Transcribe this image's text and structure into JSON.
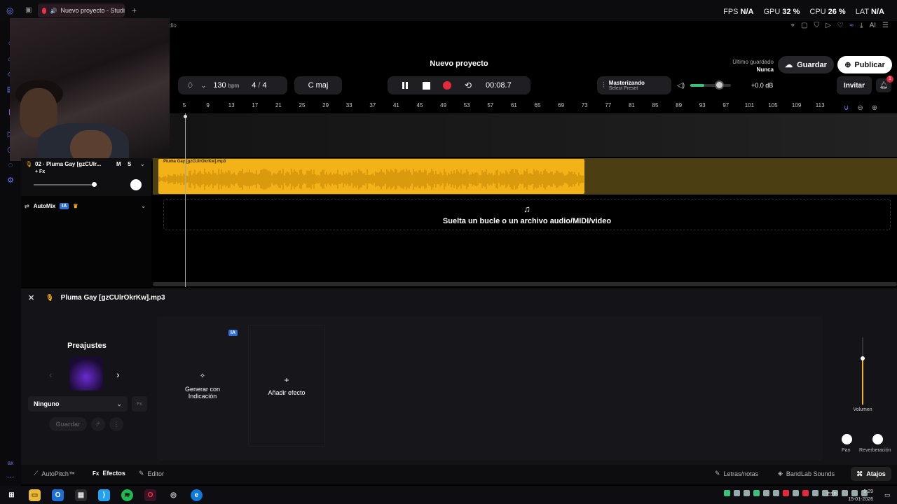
{
  "browser": {
    "tab_title": "Nuevo proyecto - Studi",
    "partial_title": "dio",
    "stats": [
      {
        "label": "FPS",
        "value": "N/A"
      },
      {
        "label": "GPU",
        "value": "32 %"
      },
      {
        "label": "CPU",
        "value": "26 %"
      },
      {
        "label": "LAT",
        "value": "N/A"
      }
    ],
    "extension_icons": [
      "pin-icon",
      "box-icon",
      "shield-icon",
      "play-icon",
      "heart-icon",
      "wave-icon",
      "download-icon",
      "ai-icon",
      "menu-icon"
    ]
  },
  "header": {
    "project_title": "Nuevo proyecto",
    "last_saved_label": "Último guardado",
    "last_saved_value": "Nunca",
    "save_label": "Guardar",
    "publish_label": "Publicar"
  },
  "transport": {
    "bpm": "130",
    "bpm_unit": "bpm",
    "time_sig_num": "4",
    "time_sig_sep": "/",
    "time_sig_den": "4",
    "key": "C maj",
    "time": "00:08.7",
    "mastering_title": "Masterizando",
    "mastering_preset": "Select Preset",
    "master_volume_fraction": 0.7,
    "db": "+0.0 dB",
    "invite_label": "Invitar",
    "notifications_count": "1",
    "record_color": "#e5283c"
  },
  "ruler": {
    "marks": [
      "5",
      "9",
      "13",
      "17",
      "21",
      "25",
      "29",
      "33",
      "37",
      "41",
      "45",
      "49",
      "53",
      "57",
      "61",
      "65",
      "69",
      "73",
      "77",
      "81",
      "85",
      "89",
      "93",
      "97",
      "101",
      "105",
      "109",
      "113"
    ]
  },
  "track": {
    "name": "02 · Pluma Gay [gzCUlr...",
    "mute": "M",
    "solo": "S",
    "fx_tag": "+ Fx",
    "clip_name": "Pluma Gay [gzCUlrOkrKw].mp3",
    "clip_color": "#f2b218",
    "volume_fraction": 0.95
  },
  "automix": {
    "label": "AutoMix",
    "badge": "IA"
  },
  "dropzone": {
    "text": "Suelta un bucle o un archivo audio/MIDI/video"
  },
  "panel": {
    "file_name": "Pluma Gay [gzCUlrOkrKw].mp3",
    "presets_title": "Preajustes",
    "preset_value": "Ninguno",
    "fx_button": "Fx",
    "save_label": "Guardar",
    "generate_label_1": "Generar con",
    "generate_label_2": "Indicación",
    "ia_badge": "IA",
    "add_effect_label": "Añadir efecto",
    "volume_label": "Volumen",
    "pan_label": "Pan",
    "reverb_label": "Reverberación",
    "volume_level": 0.69
  },
  "bottom_bar": {
    "autopitch": "AutoPitch™",
    "effects": "Efectos",
    "editor": "Editor",
    "lyrics": "Letras/notas",
    "sounds": "BandLab Sounds",
    "shortcuts": "Atajos",
    "left_label": "ax"
  },
  "taskbar": {
    "lang": "ESP",
    "time": "5:29",
    "date": "15-01-2026"
  }
}
